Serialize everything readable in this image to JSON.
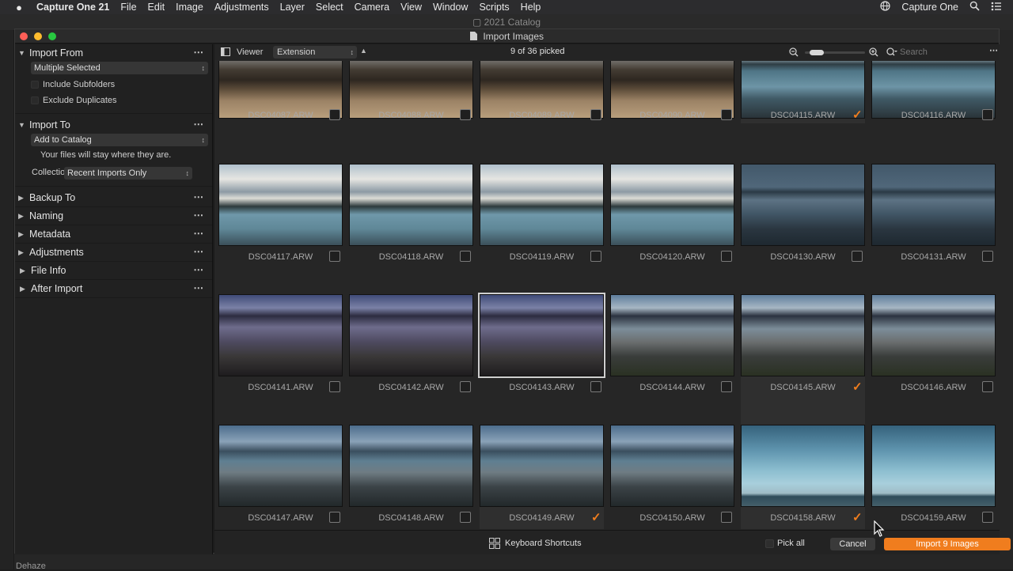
{
  "menubar": {
    "app_name": "Capture One 21",
    "items": [
      "File",
      "Edit",
      "Image",
      "Adjustments",
      "Layer",
      "Select",
      "Camera",
      "View",
      "Window",
      "Scripts",
      "Help"
    ],
    "right_label": "Capture One"
  },
  "background_window": {
    "title": "2021 Catalog",
    "bottom_label": "Dehaze"
  },
  "dialog": {
    "title": "Import Images",
    "import_from": {
      "header": "Import From",
      "source": "Multiple Selected",
      "include_subfolders": "Include Subfolders",
      "exclude_duplicates": "Exclude Duplicates"
    },
    "import_to": {
      "header": "Import To",
      "destination": "Add to Catalog",
      "note": "Your files will stay where they are.",
      "collection_label": "Collection",
      "collection_value": "Recent Imports Only"
    },
    "sections": [
      "Backup To",
      "Naming",
      "Metadata",
      "Adjustments",
      "File Info",
      "After Import"
    ],
    "viewer": {
      "label": "Viewer",
      "sort_by": "Extension",
      "picked_status": "9 of 36 picked",
      "search_placeholder": "Search"
    },
    "thumbnails": [
      {
        "filename": "DSC04087.ARW",
        "picked": false,
        "scene": "sand"
      },
      {
        "filename": "DSC04088.ARW",
        "picked": false,
        "scene": "sand"
      },
      {
        "filename": "DSC04089.ARW",
        "picked": false,
        "scene": "sand"
      },
      {
        "filename": "DSC04090.ARW",
        "picked": false,
        "scene": "sand"
      },
      {
        "filename": "DSC04115.ARW",
        "picked": true,
        "scene": "rocks-blue"
      },
      {
        "filename": "DSC04116.ARW",
        "picked": false,
        "scene": "rocks-blue"
      },
      {
        "filename": "DSC04117.ARW",
        "picked": false,
        "scene": "clouds"
      },
      {
        "filename": "DSC04118.ARW",
        "picked": false,
        "scene": "clouds"
      },
      {
        "filename": "DSC04119.ARW",
        "picked": false,
        "scene": "clouds"
      },
      {
        "filename": "DSC04120.ARW",
        "picked": false,
        "scene": "clouds"
      },
      {
        "filename": "DSC04130.ARW",
        "picked": false,
        "scene": "island"
      },
      {
        "filename": "DSC04131.ARW",
        "picked": false,
        "scene": "island"
      },
      {
        "filename": "DSC04141.ARW",
        "picked": false,
        "scene": "purple-rocks"
      },
      {
        "filename": "DSC04142.ARW",
        "picked": false,
        "scene": "purple-rocks"
      },
      {
        "filename": "DSC04143.ARW",
        "picked": false,
        "scene": "purple-rocks"
      },
      {
        "filename": "DSC04144.ARW",
        "picked": false,
        "scene": "grey-rocks"
      },
      {
        "filename": "DSC04145.ARW",
        "picked": true,
        "scene": "grey-rocks"
      },
      {
        "filename": "DSC04146.ARW",
        "picked": false,
        "scene": "grey-rocks"
      },
      {
        "filename": "DSC04147.ARW",
        "picked": false,
        "scene": "dawn-rocks"
      },
      {
        "filename": "DSC04148.ARW",
        "picked": false,
        "scene": "dawn-rocks"
      },
      {
        "filename": "DSC04149.ARW",
        "picked": true,
        "scene": "dawn-rocks"
      },
      {
        "filename": "DSC04150.ARW",
        "picked": false,
        "scene": "dawn-rocks"
      },
      {
        "filename": "DSC04158.ARW",
        "picked": true,
        "scene": "sea-sky"
      },
      {
        "filename": "DSC04159.ARW",
        "picked": false,
        "scene": "sea-sky"
      }
    ],
    "footer": {
      "keyboard_shortcuts": "Keyboard Shortcuts",
      "pick_all": "Pick all",
      "cancel": "Cancel",
      "import_button": "Import 9 Images"
    },
    "colors": {
      "accent": "#f07d1e",
      "pick_check": "#f07d1e"
    }
  }
}
